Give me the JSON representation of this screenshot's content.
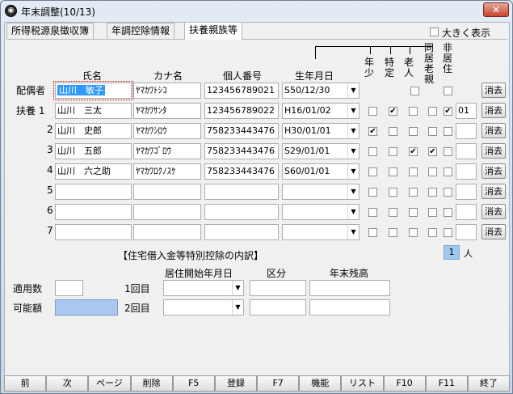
{
  "window": {
    "title": "年末調整(10/13)",
    "close_label": "✕"
  },
  "tabs": [
    {
      "label": "所得税源泉徴収簿"
    },
    {
      "label": "年調控除情報"
    },
    {
      "label": "扶養親族等"
    }
  ],
  "enlarge_label": "大きく表示",
  "headers": {
    "name": "氏名",
    "kana": "カナ名",
    "mynumber": "個人番号",
    "birth": "生年月日",
    "young": "年少",
    "special": "特定",
    "elderly": "老人",
    "cohabit": "同居老親",
    "nonresident": "非居住"
  },
  "rows": [
    {
      "label": "配偶者",
      "name": "山川　敏子",
      "kana": "ﾔﾏｶﾜﾄｼｺ",
      "mynumber": "123456789021",
      "birth": "S50/12/30",
      "young": "",
      "special": "",
      "elderly": "",
      "cohabit": "",
      "nonresident": "",
      "code": "",
      "delete": "消去"
    },
    {
      "label": "扶養 1",
      "name": "山川　三太",
      "kana": "ﾔﾏｶﾜｻﾝﾀ",
      "mynumber": "123456789022",
      "birth": "H16/01/02",
      "young": "",
      "special": "✔",
      "elderly": "",
      "cohabit": "",
      "nonresident": "✔",
      "code": "01",
      "delete": "消去"
    },
    {
      "label": "2",
      "name": "山川　史郎",
      "kana": "ﾔﾏｶﾜｼﾛｳ",
      "mynumber": "758233443476",
      "birth": "H30/01/01",
      "young": "✔",
      "special": "",
      "elderly": "",
      "cohabit": "",
      "nonresident": "",
      "code": "",
      "delete": "消去"
    },
    {
      "label": "3",
      "name": "山川　五郎",
      "kana": "ﾔﾏｶﾜｺﾞﾛｳ",
      "mynumber": "758233443476",
      "birth": "S29/01/01",
      "young": "",
      "special": "",
      "elderly": "✔",
      "cohabit": "✔",
      "nonresident": "",
      "code": "",
      "delete": "消去"
    },
    {
      "label": "4",
      "name": "山川　六之助",
      "kana": "ﾔﾏｶﾜﾛｸﾉｽｹ",
      "mynumber": "758233443476",
      "birth": "S60/01/01",
      "young": "",
      "special": "",
      "elderly": "",
      "cohabit": "",
      "nonresident": "",
      "code": "",
      "delete": "消去"
    },
    {
      "label": "5",
      "name": "",
      "kana": "",
      "mynumber": "",
      "birth": "",
      "young": "",
      "special": "",
      "elderly": "",
      "cohabit": "",
      "nonresident": "",
      "code": "",
      "delete": "消去"
    },
    {
      "label": "6",
      "name": "",
      "kana": "",
      "mynumber": "",
      "birth": "",
      "young": "",
      "special": "",
      "elderly": "",
      "cohabit": "",
      "nonresident": "",
      "code": "",
      "delete": "消去"
    },
    {
      "label": "7",
      "name": "",
      "kana": "",
      "mynumber": "",
      "birth": "",
      "young": "",
      "special": "",
      "elderly": "",
      "cohabit": "",
      "nonresident": "",
      "code": "",
      "delete": "消去"
    }
  ],
  "count": {
    "value": "1",
    "unit": "人"
  },
  "housing": {
    "title": "【住宅借入金等特別控除の内訳】",
    "col_start": "居住開始年月日",
    "col_type": "区分",
    "col_balance": "年末残高",
    "applied_label": "適用数",
    "possible_label": "可能額",
    "row1_label": "1回目",
    "row2_label": "2回目"
  },
  "fkeys": [
    "前",
    "次",
    "ページ",
    "削除",
    "F5",
    "登録",
    "F7",
    "機能",
    "リスト",
    "F10",
    "F11",
    "終了"
  ]
}
